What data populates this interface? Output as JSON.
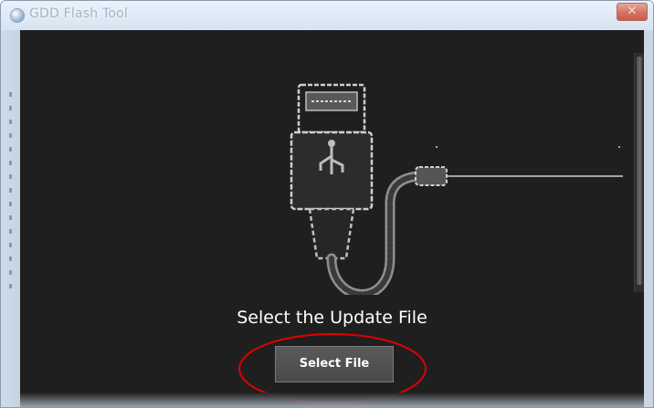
{
  "window": {
    "title": "GDD Flash Tool",
    "close_symbol": "✕"
  },
  "main": {
    "heading": "Select the Update File",
    "select_button_label": "Select File",
    "illustration": "usb-cable-icon"
  },
  "colors": {
    "content_background": "#1f1f1f",
    "text": "#ffffff",
    "button_background": "#4e4e4e",
    "highlight_ellipse": "#e00000"
  }
}
